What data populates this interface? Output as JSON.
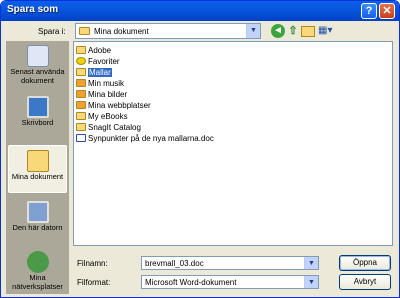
{
  "window": {
    "title": "Spara som"
  },
  "titlebar_buttons": {
    "help": "?",
    "close": "✕"
  },
  "toolbar": {
    "look_in_label": "Spara i:",
    "look_in_value": "Mina dokument",
    "back_glyph": "◄",
    "up_glyph": "⇧",
    "views_glyph": "▦▾"
  },
  "places": [
    {
      "label": "Senast använda dokument",
      "icon": "recent-documents-icon"
    },
    {
      "label": "Skrivbord",
      "icon": "desktop-icon"
    },
    {
      "label": "Mina dokument",
      "icon": "my-documents-icon"
    },
    {
      "label": "Den här datorn",
      "icon": "my-computer-icon"
    },
    {
      "label": "Mina nätverksplatser",
      "icon": "network-places-icon"
    }
  ],
  "files": [
    {
      "name": "Adobe",
      "type": "folder"
    },
    {
      "name": "Favoriter",
      "type": "favorites"
    },
    {
      "name": "Mallar",
      "type": "folder",
      "selected": true
    },
    {
      "name": "Min musik",
      "type": "folder"
    },
    {
      "name": "Mina bilder",
      "type": "folder"
    },
    {
      "name": "Mina webbplatser",
      "type": "folder"
    },
    {
      "name": "My eBooks",
      "type": "folder"
    },
    {
      "name": "SnagIt Catalog",
      "type": "folder"
    },
    {
      "name": "Synpunkter på de nya mallarna.doc",
      "type": "document"
    }
  ],
  "filename": {
    "label": "Filnamn:",
    "value": "brevmall_03.doc"
  },
  "filetype": {
    "label": "Filformat:",
    "value": "Microsoft Word-dokument"
  },
  "buttons": {
    "save": "Öppna",
    "cancel": "Avbryt"
  },
  "colors": {
    "titlebar": "#0855dd",
    "selection": "#316ac5",
    "dialog_bg": "#ece9d8"
  }
}
